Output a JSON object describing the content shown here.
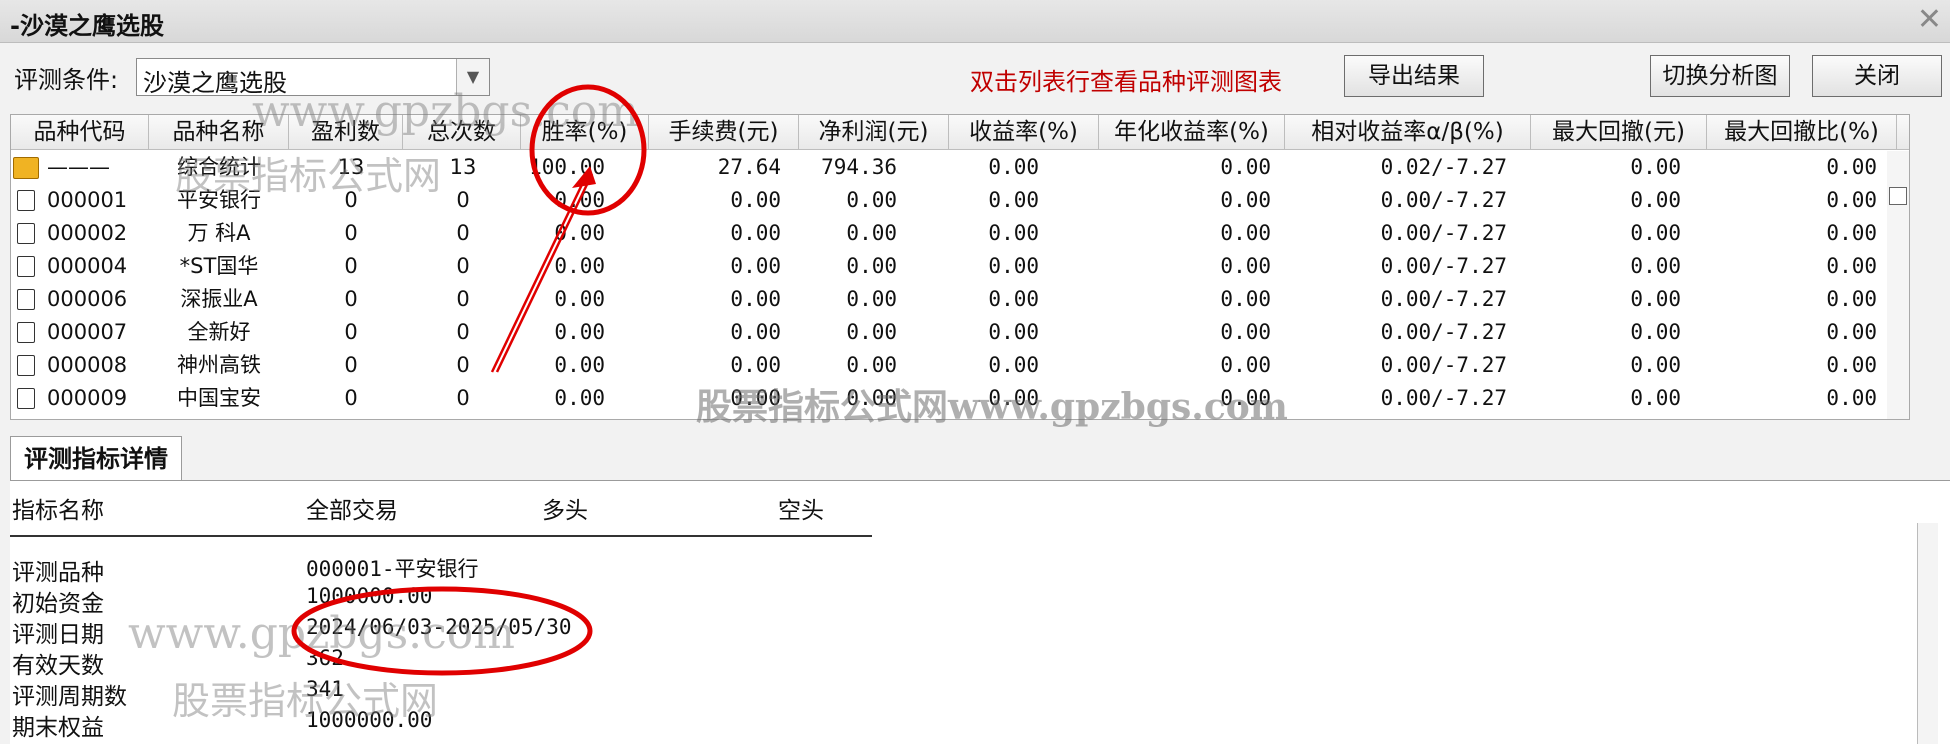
{
  "window": {
    "title": "-沙漠之鹰选股",
    "close_glyph": "✕"
  },
  "toolbar": {
    "condition_label": "评测条件:",
    "condition_value": "沙漠之鹰选股",
    "hint": "双击列表行查看品种评测图表",
    "export_label": "导出结果",
    "switch_label": "切换分析图",
    "close_label": "关闭"
  },
  "table": {
    "headers": [
      "品种代码",
      "品种名称",
      "盈利数",
      "总次数",
      "胜率(%)",
      "手续费(元)",
      "净利润(元)",
      "收益率(%)",
      "年化收益率(%)",
      "相对收益率α/β(%)",
      "最大回撤(元)",
      "最大回撤比(%)"
    ],
    "rows": [
      {
        "code": "———",
        "name": "综合统计",
        "win": "13",
        "total": "13",
        "rate": "100.00",
        "fee": "27.64",
        "profit": "794.36",
        "ret": "0.00",
        "annual": "0.00",
        "alpha": "0.02/-7.27",
        "dd": "0.00",
        "ddr": "0.00",
        "icon": "folder-icon"
      },
      {
        "code": "000001",
        "name": "平安银行",
        "win": "0",
        "total": "0",
        "rate": "0.00",
        "fee": "0.00",
        "profit": "0.00",
        "ret": "0.00",
        "annual": "0.00",
        "alpha": "0.00/-7.27",
        "dd": "0.00",
        "ddr": "0.00",
        "icon": "document-icon"
      },
      {
        "code": "000002",
        "name": "万 科A",
        "win": "0",
        "total": "0",
        "rate": "0.00",
        "fee": "0.00",
        "profit": "0.00",
        "ret": "0.00",
        "annual": "0.00",
        "alpha": "0.00/-7.27",
        "dd": "0.00",
        "ddr": "0.00",
        "icon": "document-icon"
      },
      {
        "code": "000004",
        "name": "*ST国华",
        "win": "0",
        "total": "0",
        "rate": "0.00",
        "fee": "0.00",
        "profit": "0.00",
        "ret": "0.00",
        "annual": "0.00",
        "alpha": "0.00/-7.27",
        "dd": "0.00",
        "ddr": "0.00",
        "icon": "document-icon"
      },
      {
        "code": "000006",
        "name": "深振业A",
        "win": "0",
        "total": "0",
        "rate": "0.00",
        "fee": "0.00",
        "profit": "0.00",
        "ret": "0.00",
        "annual": "0.00",
        "alpha": "0.00/-7.27",
        "dd": "0.00",
        "ddr": "0.00",
        "icon": "document-icon"
      },
      {
        "code": "000007",
        "name": "全新好",
        "win": "0",
        "total": "0",
        "rate": "0.00",
        "fee": "0.00",
        "profit": "0.00",
        "ret": "0.00",
        "annual": "0.00",
        "alpha": "0.00/-7.27",
        "dd": "0.00",
        "ddr": "0.00",
        "icon": "document-icon"
      },
      {
        "code": "000008",
        "name": "神州高铁",
        "win": "0",
        "total": "0",
        "rate": "0.00",
        "fee": "0.00",
        "profit": "0.00",
        "ret": "0.00",
        "annual": "0.00",
        "alpha": "0.00/-7.27",
        "dd": "0.00",
        "ddr": "0.00",
        "icon": "document-icon"
      },
      {
        "code": "000009",
        "name": "中国宝安",
        "win": "0",
        "total": "0",
        "rate": "0.00",
        "fee": "0.00",
        "profit": "0.00",
        "ret": "0.00",
        "annual": "0.00",
        "alpha": "0.00/-7.27",
        "dd": "0.00",
        "ddr": "0.00",
        "icon": "document-icon"
      }
    ]
  },
  "detail": {
    "tab_label": "评测指标详情",
    "headers": [
      "指标名称",
      "全部交易",
      "多头",
      "空头"
    ],
    "rows": [
      {
        "key": "评测品种",
        "value": "000001-平安银行"
      },
      {
        "key": "初始资金",
        "value": "1000000.00"
      },
      {
        "key": "评测日期",
        "value": "2024/06/03-2025/05/30"
      },
      {
        "key": "有效天数",
        "value": "362"
      },
      {
        "key": "评测周期数",
        "value": "341"
      },
      {
        "key": "期末权益",
        "value": "1000000.00"
      }
    ]
  },
  "watermarks": [
    "www.gpzbgs.com",
    "股票指标公式网",
    "股票指标公式网www.gpzbgs.com",
    "www.gpzbgs.com",
    "股票指标公式网"
  ],
  "colors": {
    "annotation": "#e00000",
    "hint_text": "#c00000",
    "folder_icon": "#f0b323"
  }
}
